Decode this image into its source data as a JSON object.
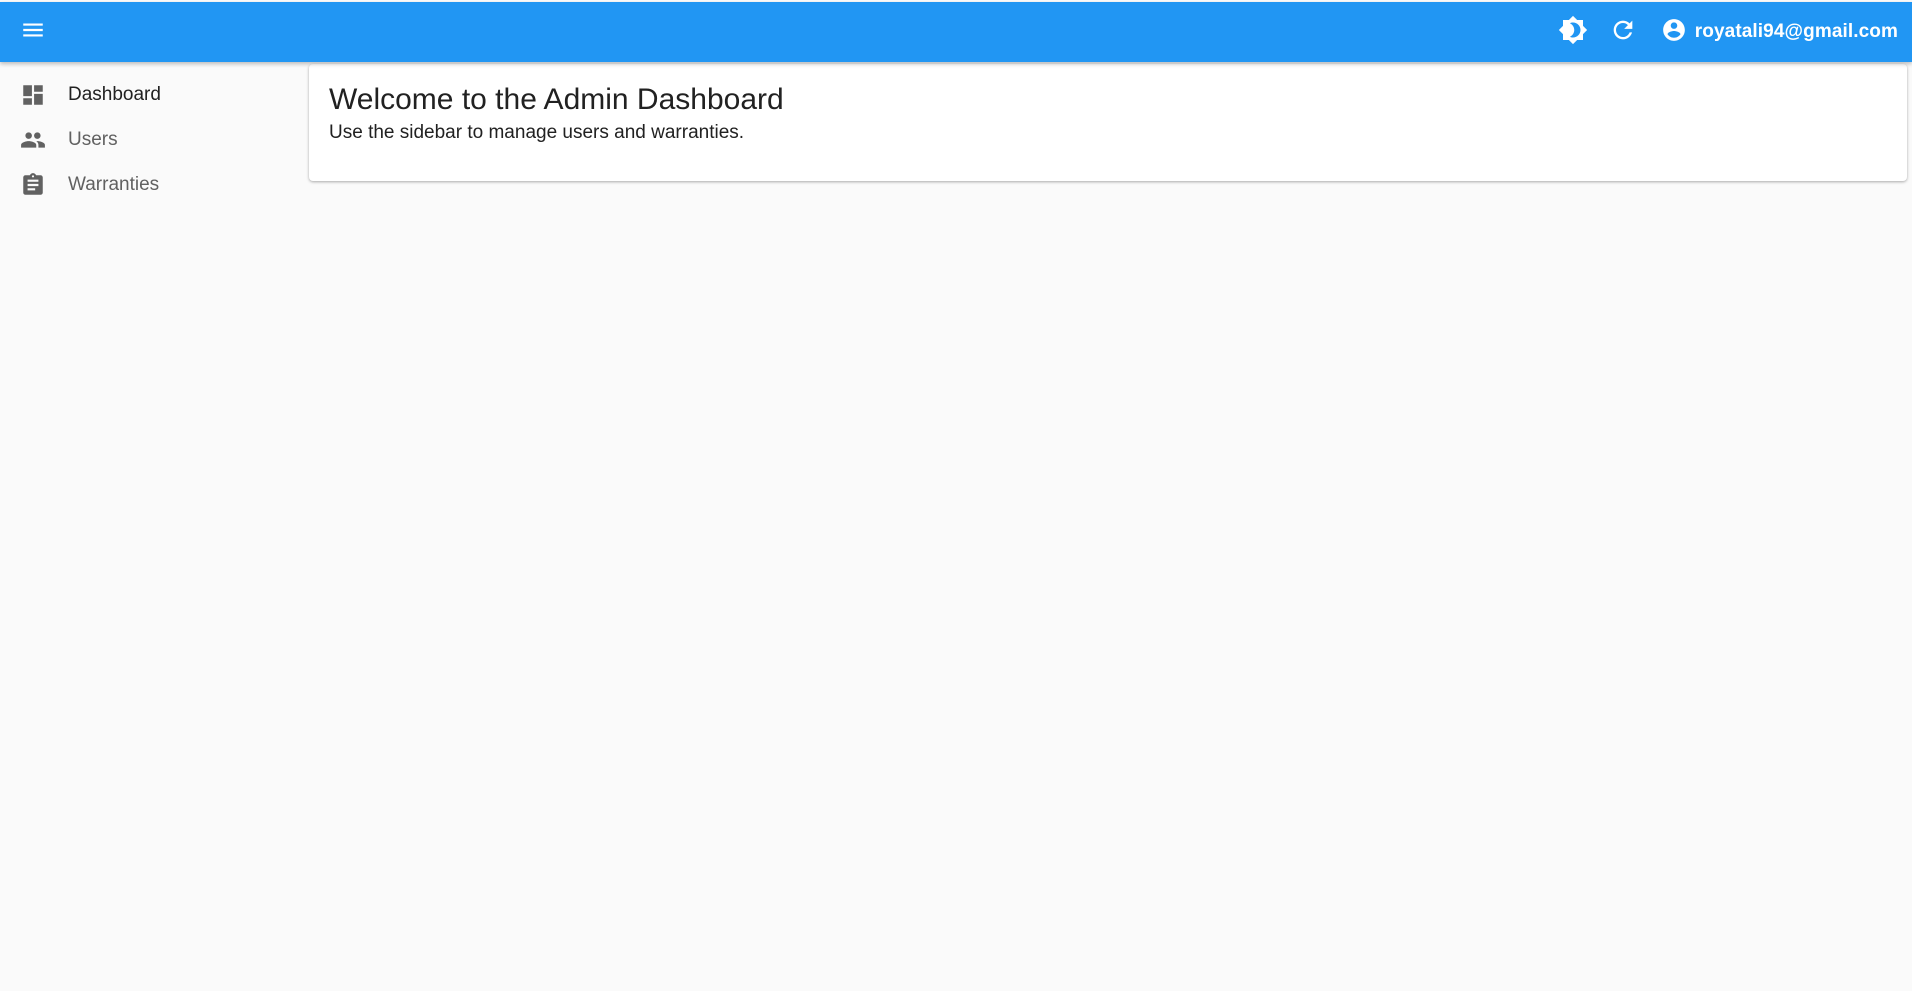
{
  "appbar": {
    "menu_icon": "menu-icon",
    "theme_icon": "brightness-icon",
    "refresh_icon": "refresh-icon",
    "account_icon": "account-circle-icon",
    "user_email": "royatali94@gmail.com",
    "color": "#2196f3"
  },
  "sidebar": {
    "items": [
      {
        "label": "Dashboard",
        "icon": "dashboard-icon",
        "active": true
      },
      {
        "label": "Users",
        "icon": "people-icon",
        "active": false
      },
      {
        "label": "Warranties",
        "icon": "clipboard-icon",
        "active": false
      }
    ]
  },
  "main": {
    "title": "Welcome to the Admin Dashboard",
    "subtitle": "Use the sidebar to manage users and warranties."
  }
}
